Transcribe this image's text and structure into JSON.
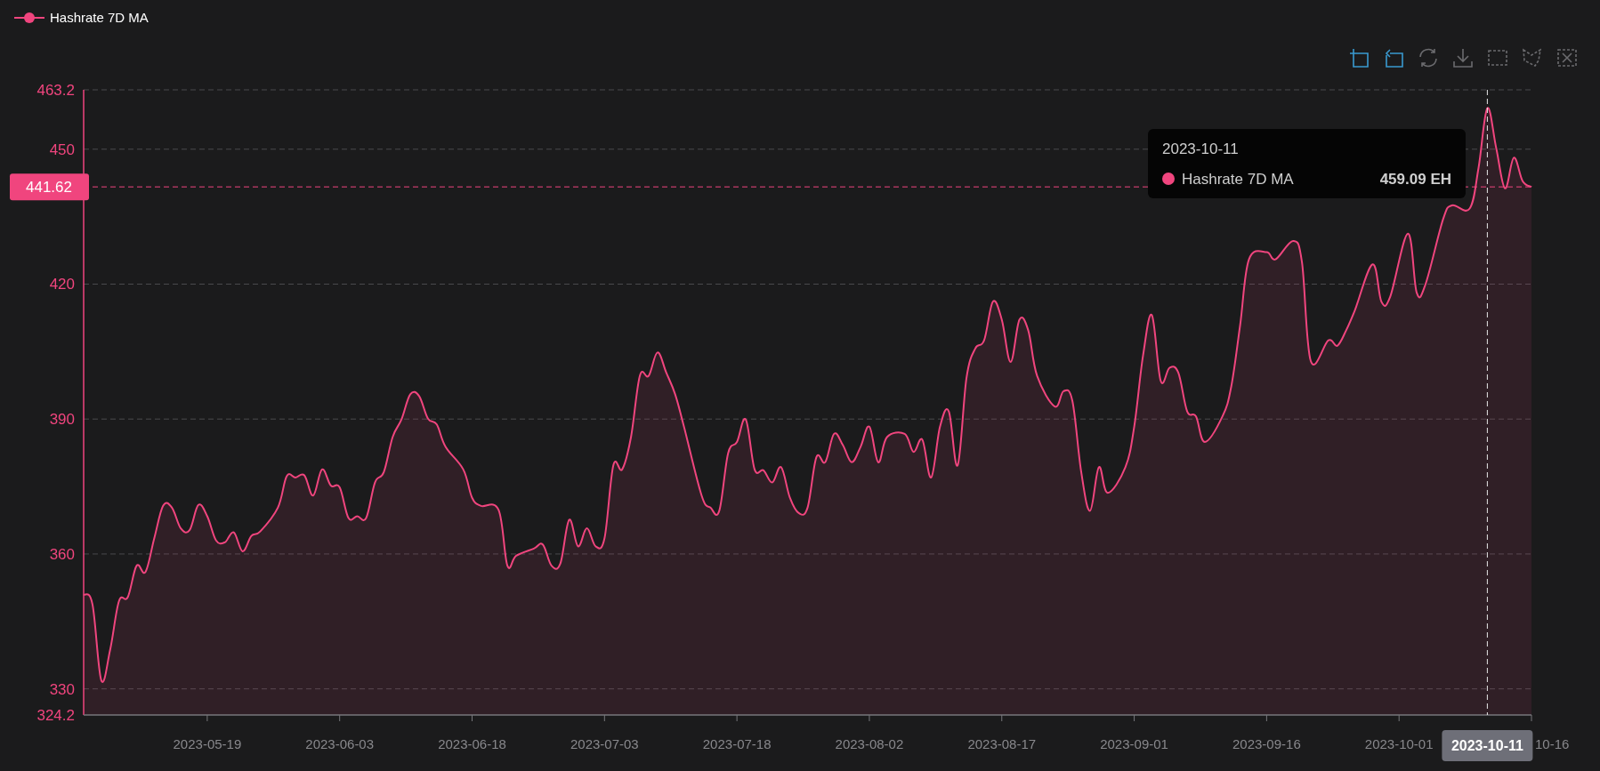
{
  "toolbox": [
    {
      "kind": "zoom",
      "active": true
    },
    {
      "kind": "back",
      "active": true
    },
    {
      "kind": "restore",
      "active": false
    },
    {
      "kind": "download",
      "active": false
    },
    {
      "kind": "rect",
      "active": false
    },
    {
      "kind": "lasso",
      "active": false
    },
    {
      "kind": "clear",
      "active": false
    }
  ],
  "chart": {
    "chart_data": {
      "type": "area",
      "grid": true,
      "xlim": [
        "2023-05-05",
        "2023-10-16"
      ],
      "ylim": [
        324.2,
        463.2
      ],
      "yticks": [
        324.2,
        330,
        360,
        390,
        420,
        450,
        463.2
      ],
      "xticks": [
        "2023-05-19",
        "2023-06-03",
        "2023-06-18",
        "2023-07-03",
        "2023-07-18",
        "2023-08-02",
        "2023-08-17",
        "2023-09-01",
        "2023-09-16",
        "2023-10-01"
      ],
      "x": [
        "2023-05-05",
        "2023-05-06",
        "2023-05-07",
        "2023-05-08",
        "2023-05-09",
        "2023-05-10",
        "2023-05-11",
        "2023-05-12",
        "2023-05-13",
        "2023-05-14",
        "2023-05-15",
        "2023-05-16",
        "2023-05-17",
        "2023-05-18",
        "2023-05-19",
        "2023-05-20",
        "2023-05-21",
        "2023-05-22",
        "2023-05-23",
        "2023-05-24",
        "2023-05-25",
        "2023-05-27",
        "2023-05-28",
        "2023-05-29",
        "2023-05-30",
        "2023-05-31",
        "2023-06-01",
        "2023-06-02",
        "2023-06-03",
        "2023-06-04",
        "2023-06-05",
        "2023-06-06",
        "2023-06-07",
        "2023-06-08",
        "2023-06-09",
        "2023-06-10",
        "2023-06-11",
        "2023-06-12",
        "2023-06-13",
        "2023-06-14",
        "2023-06-15",
        "2023-06-17",
        "2023-06-18",
        "2023-06-19",
        "2023-06-21",
        "2023-06-22",
        "2023-06-23",
        "2023-06-25",
        "2023-06-26",
        "2023-06-27",
        "2023-06-28",
        "2023-06-29",
        "2023-06-30",
        "2023-07-01",
        "2023-07-02",
        "2023-07-03",
        "2023-07-04",
        "2023-07-05",
        "2023-07-06",
        "2023-07-07",
        "2023-07-08",
        "2023-07-09",
        "2023-07-10",
        "2023-07-11",
        "2023-07-12",
        "2023-07-14",
        "2023-07-15",
        "2023-07-16",
        "2023-07-17",
        "2023-07-18",
        "2023-07-19",
        "2023-07-20",
        "2023-07-21",
        "2023-07-22",
        "2023-07-23",
        "2023-07-24",
        "2023-07-25",
        "2023-07-26",
        "2023-07-27",
        "2023-07-28",
        "2023-07-29",
        "2023-07-30",
        "2023-07-31",
        "2023-08-01",
        "2023-08-02",
        "2023-08-03",
        "2023-08-04",
        "2023-08-06",
        "2023-08-07",
        "2023-08-08",
        "2023-08-09",
        "2023-08-10",
        "2023-08-11",
        "2023-08-12",
        "2023-08-13",
        "2023-08-14",
        "2023-08-15",
        "2023-08-16",
        "2023-08-17",
        "2023-08-18",
        "2023-08-19",
        "2023-08-20",
        "2023-08-21",
        "2023-08-23",
        "2023-08-24",
        "2023-08-25",
        "2023-08-26",
        "2023-08-27",
        "2023-08-28",
        "2023-08-29",
        "2023-08-31",
        "2023-09-01",
        "2023-09-02",
        "2023-09-03",
        "2023-09-04",
        "2023-09-05",
        "2023-09-06",
        "2023-09-07",
        "2023-09-08",
        "2023-09-09",
        "2023-09-11",
        "2023-09-12",
        "2023-09-13",
        "2023-09-14",
        "2023-09-16",
        "2023-09-17",
        "2023-09-19",
        "2023-09-20",
        "2023-09-21",
        "2023-09-23",
        "2023-09-24",
        "2023-09-25",
        "2023-09-26",
        "2023-09-28",
        "2023-09-29",
        "2023-09-30",
        "2023-10-02",
        "2023-10-03",
        "2023-10-04",
        "2023-10-06",
        "2023-10-07",
        "2023-10-09",
        "2023-10-10",
        "2023-10-11",
        "2023-10-12",
        "2023-10-13",
        "2023-10-14",
        "2023-10-15",
        "2023-10-16"
      ],
      "series": [
        {
          "name": "Hashrate 7D MA",
          "color": "#f0457e",
          "values": [
            351,
            348.8,
            331.9,
            338.7,
            349.5,
            350.4,
            357.4,
            356,
            363.5,
            370.7,
            370.3,
            365.7,
            365.3,
            370.9,
            368.4,
            363,
            362.6,
            364.8,
            360.6,
            364,
            365,
            370.3,
            377.3,
            377,
            377.5,
            373,
            378.8,
            375.2,
            374.8,
            368,
            368.4,
            368,
            375.9,
            378.2,
            386,
            389.9,
            395.5,
            395.1,
            390.1,
            388.8,
            383.8,
            378.8,
            372.5,
            370.7,
            369.8,
            357.4,
            359.6,
            361.2,
            362.1,
            357.4,
            357.9,
            367.6,
            361.7,
            365.7,
            361.7,
            363.5,
            379.7,
            378.8,
            386,
            399.6,
            399.6,
            404.8,
            400.3,
            395.5,
            388.3,
            373,
            370.3,
            369.6,
            382.4,
            384.9,
            389.9,
            378.8,
            378.6,
            375.9,
            379.3,
            372.5,
            369.1,
            370.3,
            381.5,
            380.4,
            386.7,
            384.2,
            380.4,
            383.8,
            388.3,
            380.4,
            386,
            386.7,
            382.7,
            385.4,
            377,
            388.3,
            391.7,
            379.7,
            399.1,
            405.7,
            407.5,
            416.1,
            412.1,
            402.7,
            412.1,
            409.7,
            399.6,
            392.8,
            396.2,
            394,
            378.2,
            369.6,
            379.3,
            373.6,
            379.3,
            388.3,
            404.1,
            413.1,
            398.5,
            401.4,
            400.3,
            391.7,
            390.6,
            384.9,
            390.6,
            397.3,
            410.9,
            425.5,
            427.1,
            425.5,
            429.6,
            424.9,
            402.9,
            407.5,
            406.3,
            409.7,
            414.2,
            424.4,
            416.1,
            417.2,
            431.2,
            418.1,
            420,
            434.5,
            437.5,
            436.8,
            445.8,
            459.1,
            450.3,
            441.3,
            448.1,
            442.9,
            441.6
          ]
        }
      ],
      "annotations": [
        {
          "text": "10-16",
          "x": "2023-10-16",
          "y": 324.2
        }
      ],
      "ref_lines": [
        {
          "axis": "x",
          "value": "2023-10-11",
          "label": "2023-10-11"
        },
        {
          "axis": "y",
          "value": 441.62,
          "label": "441.62"
        }
      ]
    },
    "tooltip": {
      "title": "2023-10-11",
      "series": "Hashrate 7D MA",
      "value": "459.09 EH"
    }
  }
}
